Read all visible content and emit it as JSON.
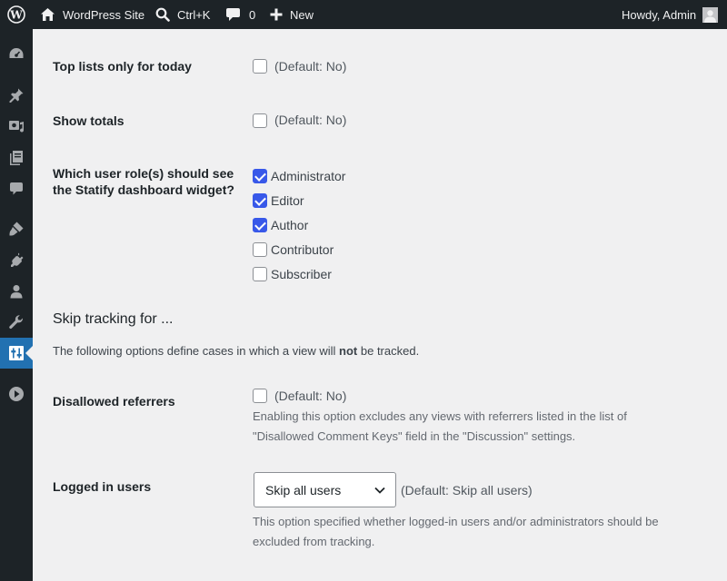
{
  "adminbar": {
    "site_name": "WordPress Site",
    "search_shortcut": "Ctrl+K",
    "comments_count": "0",
    "new_label": "New",
    "greeting": "Howdy, Admin"
  },
  "sidebar": {
    "items": [
      {
        "icon": "dashboard-icon"
      },
      {
        "icon": "pin-icon"
      },
      {
        "icon": "media-icon"
      },
      {
        "icon": "pages-icon"
      },
      {
        "icon": "comments-icon"
      },
      {
        "icon": "appearance-icon"
      },
      {
        "icon": "plugins-icon"
      },
      {
        "icon": "users-icon"
      },
      {
        "icon": "tools-icon"
      },
      {
        "icon": "settings-icon",
        "current": true
      },
      {
        "icon": "collapse-icon"
      }
    ]
  },
  "settings": {
    "top_lists": {
      "label": "Top lists only for today",
      "checked": false,
      "default": "(Default: No)"
    },
    "show_totals": {
      "label": "Show totals",
      "checked": false,
      "default": "(Default: No)"
    },
    "roles": {
      "label_line1": "Which user role(s) should see",
      "label_line2": "the Statify dashboard widget?",
      "options": [
        {
          "label": "Administrator",
          "checked": true
        },
        {
          "label": "Editor",
          "checked": true
        },
        {
          "label": "Author",
          "checked": true
        },
        {
          "label": "Contributor",
          "checked": false
        },
        {
          "label": "Subscriber",
          "checked": false
        }
      ]
    },
    "skip_section": {
      "title": "Skip tracking for ...",
      "desc_before": "The following options define cases in which a view will ",
      "desc_bold": "not",
      "desc_after": " be tracked."
    },
    "disallowed_referrers": {
      "label": "Disallowed referrers",
      "checked": false,
      "default": "(Default: No)",
      "desc_line1": "Enabling this option excludes any views with referrers listed in the list of",
      "desc_line2": "\"Disallowed Comment Keys\" field in the \"Discussion\" settings."
    },
    "logged_in_users": {
      "label": "Logged in users",
      "selected": "Skip all users",
      "default": "(Default: Skip all users)",
      "desc_line1": "This option specified whether logged-in users and/or administrators should be",
      "desc_line2": "excluded from tracking."
    }
  },
  "colors": {
    "accent": "#3858e9",
    "menu_current": "#2271b1",
    "adminbar_bg": "#1d2327"
  }
}
